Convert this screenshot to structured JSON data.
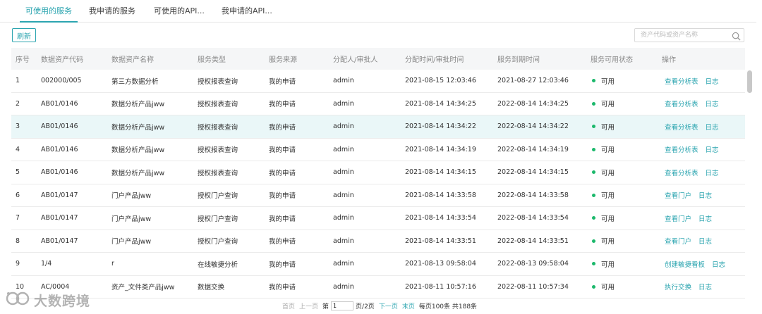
{
  "tabs": [
    {
      "label": "可使用的服务",
      "active": true
    },
    {
      "label": "我申请的服务",
      "active": false
    },
    {
      "label": "可使用的API...",
      "active": false
    },
    {
      "label": "我申请的API...",
      "active": false
    }
  ],
  "toolbar": {
    "refresh_label": "刷新"
  },
  "search": {
    "placeholder": "资产代码或资产名称"
  },
  "table": {
    "headers": [
      "序号",
      "数据资产代码",
      "数据资产名称",
      "服务类型",
      "服务来源",
      "分配人/审批人",
      "分配时间/审批时间",
      "服务到期时间",
      "服务可用状态",
      "操作"
    ],
    "rows": [
      {
        "no": "1",
        "code": "002000/005",
        "name": "第三方数据分析",
        "type": "授权报表查询",
        "source": "我的申请",
        "assignee": "admin",
        "assign_time": "2021-08-15 12:03:46",
        "expire": "2021-08-27 12:03:46",
        "status": "可用",
        "actions": [
          "查看分析表",
          "日志"
        ]
      },
      {
        "no": "2",
        "code": "AB01/0146",
        "name": "数据分析产品jww",
        "type": "授权报表查询",
        "source": "我的申请",
        "assignee": "admin",
        "assign_time": "2021-08-14 14:34:25",
        "expire": "2022-08-14 14:34:25",
        "status": "可用",
        "actions": [
          "查看分析表",
          "日志"
        ]
      },
      {
        "no": "3",
        "code": "AB01/0146",
        "name": "数据分析产品jww",
        "type": "授权报表查询",
        "source": "我的申请",
        "assignee": "admin",
        "assign_time": "2021-08-14 14:34:22",
        "expire": "2022-08-14 14:34:22",
        "status": "可用",
        "actions": [
          "查看分析表",
          "日志"
        ]
      },
      {
        "no": "4",
        "code": "AB01/0146",
        "name": "数据分析产品jww",
        "type": "授权报表查询",
        "source": "我的申请",
        "assignee": "admin",
        "assign_time": "2021-08-14 14:34:19",
        "expire": "2022-08-14 14:34:19",
        "status": "可用",
        "actions": [
          "查看分析表",
          "日志"
        ]
      },
      {
        "no": "5",
        "code": "AB01/0146",
        "name": "数据分析产品jww",
        "type": "授权报表查询",
        "source": "我的申请",
        "assignee": "admin",
        "assign_time": "2021-08-14 14:34:15",
        "expire": "2022-08-14 14:34:15",
        "status": "可用",
        "actions": [
          "查看分析表",
          "日志"
        ]
      },
      {
        "no": "6",
        "code": "AB01/0147",
        "name": "门户产品jww",
        "type": "授权门户查询",
        "source": "我的申请",
        "assignee": "admin",
        "assign_time": "2021-08-14 14:33:58",
        "expire": "2022-08-14 14:33:58",
        "status": "可用",
        "actions": [
          "查看门户",
          "日志"
        ]
      },
      {
        "no": "7",
        "code": "AB01/0147",
        "name": "门户产品jww",
        "type": "授权门户查询",
        "source": "我的申请",
        "assignee": "admin",
        "assign_time": "2021-08-14 14:33:54",
        "expire": "2022-08-14 14:33:54",
        "status": "可用",
        "actions": [
          "查看门户",
          "日志"
        ]
      },
      {
        "no": "8",
        "code": "AB01/0147",
        "name": "门户产品jww",
        "type": "授权门户查询",
        "source": "我的申请",
        "assignee": "admin",
        "assign_time": "2021-08-14 14:33:51",
        "expire": "2022-08-14 14:33:51",
        "status": "可用",
        "actions": [
          "查看门户",
          "日志"
        ]
      },
      {
        "no": "9",
        "code": "1/4",
        "name": "r",
        "type": "在线敏捷分析",
        "source": "我的申请",
        "assignee": "admin",
        "assign_time": "2021-08-13 09:58:04",
        "expire": "2022-08-13 09:58:04",
        "status": "可用",
        "actions": [
          "创建敏捷看板",
          "日志"
        ]
      },
      {
        "no": "10",
        "code": "AC/0004",
        "name": "资产_文件类产品jww",
        "type": "数据交换",
        "source": "我的申请",
        "assignee": "admin",
        "assign_time": "2021-08-11 10:57:16",
        "expire": "2022-08-11 10:57:34",
        "status": "可用",
        "actions": [
          "执行交换",
          "日志"
        ]
      }
    ]
  },
  "pagination": {
    "first": "首页",
    "prev": "上一页",
    "page_prefix": "第",
    "current_page": "1",
    "page_suffix": "页/2页",
    "next": "下一页",
    "last": "末页",
    "summary": "每页100条 共188条"
  },
  "watermark": {
    "text": "大数跨境"
  },
  "colors": {
    "accent": "#2ca5b0",
    "status_ok": "#1bb86b",
    "row_highlight": "#eaf7f8"
  }
}
